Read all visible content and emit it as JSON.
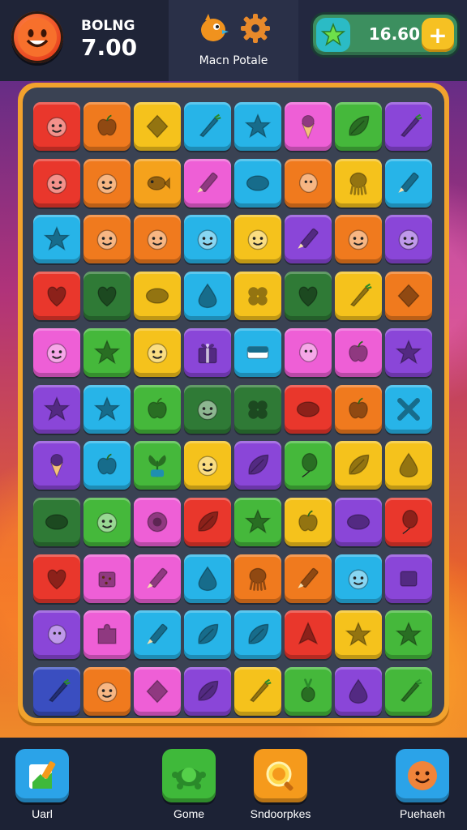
{
  "header": {
    "score_label": "BOLNG",
    "score_value": "7.00",
    "mid_label": "Macn Potale",
    "coins": "16.60",
    "plus": "+"
  },
  "board": {
    "rows": [
      [
        {
          "c": "#e9372c",
          "i": "face"
        },
        {
          "c": "#f07a1e",
          "i": "apple"
        },
        {
          "c": "#f5c21c",
          "i": "diamond"
        },
        {
          "c": "#27b4e8",
          "i": "carrot"
        },
        {
          "c": "#27b4e8",
          "i": "star"
        },
        {
          "c": "#ee5fd6",
          "i": "cone"
        },
        {
          "c": "#45b83b",
          "i": "leaf"
        },
        {
          "c": "#8a46d8",
          "i": "carrot"
        }
      ],
      [
        {
          "c": "#e9372c",
          "i": "face"
        },
        {
          "c": "#f07a1e",
          "i": "face"
        },
        {
          "c": "#f5a21c",
          "i": "fish"
        },
        {
          "c": "#ee5fd6",
          "i": "pencil"
        },
        {
          "c": "#27b4e8",
          "i": "oval"
        },
        {
          "c": "#f07a1e",
          "i": "blob"
        },
        {
          "c": "#f5c21c",
          "i": "squid"
        },
        {
          "c": "#27b4e8",
          "i": "pencil"
        }
      ],
      [
        {
          "c": "#27b4e8",
          "i": "star"
        },
        {
          "c": "#f07a1e",
          "i": "face"
        },
        {
          "c": "#f07a1e",
          "i": "face"
        },
        {
          "c": "#27b4e8",
          "i": "face"
        },
        {
          "c": "#f5c21c",
          "i": "face"
        },
        {
          "c": "#8a46d8",
          "i": "pencil"
        },
        {
          "c": "#f07a1e",
          "i": "face"
        },
        {
          "c": "#8a46d8",
          "i": "face"
        }
      ],
      [
        {
          "c": "#e9372c",
          "i": "heart"
        },
        {
          "c": "#2f7a36",
          "i": "heart"
        },
        {
          "c": "#f5c21c",
          "i": "oval"
        },
        {
          "c": "#27b4e8",
          "i": "drop"
        },
        {
          "c": "#f5c21c",
          "i": "clover"
        },
        {
          "c": "#2f7a36",
          "i": "heart"
        },
        {
          "c": "#f5c21c",
          "i": "carrot"
        },
        {
          "c": "#f07a1e",
          "i": "diamond"
        }
      ],
      [
        {
          "c": "#ee5fd6",
          "i": "face"
        },
        {
          "c": "#45b83b",
          "i": "star"
        },
        {
          "c": "#f5c21c",
          "i": "face"
        },
        {
          "c": "#8a46d8",
          "i": "gift"
        },
        {
          "c": "#27b4e8",
          "i": "flag"
        },
        {
          "c": "#ee5fd6",
          "i": "blob"
        },
        {
          "c": "#ee5fd6",
          "i": "apple"
        },
        {
          "c": "#8a46d8",
          "i": "star"
        }
      ],
      [
        {
          "c": "#8a46d8",
          "i": "star"
        },
        {
          "c": "#27b4e8",
          "i": "star"
        },
        {
          "c": "#45b83b",
          "i": "apple"
        },
        {
          "c": "#2f7a36",
          "i": "face"
        },
        {
          "c": "#2f7a36",
          "i": "clover"
        },
        {
          "c": "#e9372c",
          "i": "oval"
        },
        {
          "c": "#f07a1e",
          "i": "apple"
        },
        {
          "c": "#27b4e8",
          "i": "cross"
        }
      ],
      [
        {
          "c": "#8a46d8",
          "i": "cone"
        },
        {
          "c": "#27b4e8",
          "i": "apple"
        },
        {
          "c": "#45b83b",
          "i": "plant"
        },
        {
          "c": "#f5c21c",
          "i": "face"
        },
        {
          "c": "#8a46d8",
          "i": "leaf"
        },
        {
          "c": "#45b83b",
          "i": "balloon"
        },
        {
          "c": "#f5c21c",
          "i": "leaf"
        },
        {
          "c": "#f5c21c",
          "i": "drop"
        }
      ],
      [
        {
          "c": "#2f7a36",
          "i": "oval"
        },
        {
          "c": "#45b83b",
          "i": "face"
        },
        {
          "c": "#ee5fd6",
          "i": "ring"
        },
        {
          "c": "#e9372c",
          "i": "leaf"
        },
        {
          "c": "#45b83b",
          "i": "star"
        },
        {
          "c": "#f5c21c",
          "i": "apple"
        },
        {
          "c": "#8a46d8",
          "i": "oval"
        },
        {
          "c": "#e9372c",
          "i": "balloon"
        }
      ],
      [
        {
          "c": "#e9372c",
          "i": "heart"
        },
        {
          "c": "#ee5fd6",
          "i": "cookie"
        },
        {
          "c": "#ee5fd6",
          "i": "pencil"
        },
        {
          "c": "#27b4e8",
          "i": "drop"
        },
        {
          "c": "#f07a1e",
          "i": "squid"
        },
        {
          "c": "#f07a1e",
          "i": "pencil"
        },
        {
          "c": "#27b4e8",
          "i": "face"
        },
        {
          "c": "#8a46d8",
          "i": "square"
        }
      ],
      [
        {
          "c": "#8a46d8",
          "i": "blob"
        },
        {
          "c": "#ee5fd6",
          "i": "puzzle"
        },
        {
          "c": "#27b4e8",
          "i": "pencil"
        },
        {
          "c": "#27b4e8",
          "i": "leaf"
        },
        {
          "c": "#27b4e8",
          "i": "leaf"
        },
        {
          "c": "#e9372c",
          "i": "arrow"
        },
        {
          "c": "#f5c21c",
          "i": "star"
        },
        {
          "c": "#45b83b",
          "i": "star"
        }
      ],
      [
        {
          "c": "#3a4ec0",
          "i": "carrot"
        },
        {
          "c": "#f07a1e",
          "i": "face"
        },
        {
          "c": "#ee5fd6",
          "i": "diamond"
        },
        {
          "c": "#8a46d8",
          "i": "leaf"
        },
        {
          "c": "#f5c21c",
          "i": "carrot"
        },
        {
          "c": "#45b83b",
          "i": "radish"
        },
        {
          "c": "#8a46d8",
          "i": "drop"
        },
        {
          "c": "#45b83b",
          "i": "carrot"
        }
      ]
    ]
  },
  "nav": [
    {
      "label": "Uarl",
      "color": "#2ba3e8",
      "icon": "notepad-icon"
    },
    {
      "label": "Gome",
      "color": "#3fb93a",
      "icon": "turtle-icon"
    },
    {
      "label": "Sndoorpkes",
      "color": "#f59a1c",
      "icon": "magnifier-icon"
    },
    {
      "label": "Puehaeh",
      "color": "#2ba3e8",
      "icon": "face-icon"
    }
  ]
}
